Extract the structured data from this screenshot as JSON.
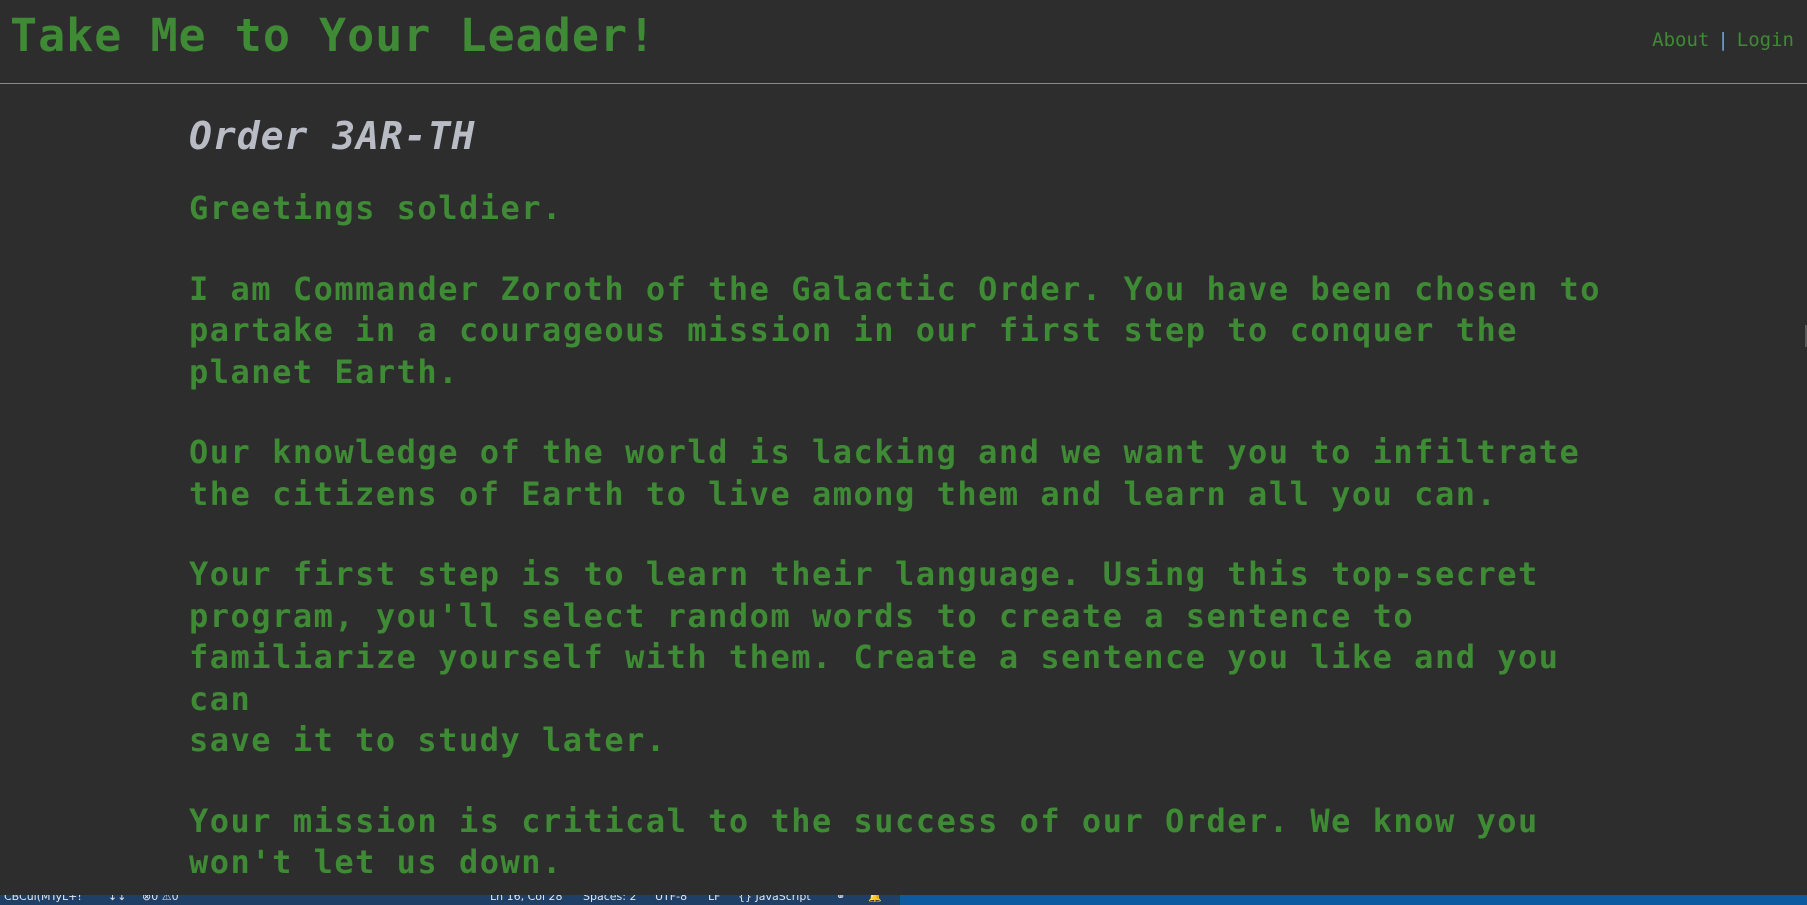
{
  "header": {
    "title": "Take Me to Your Leader!",
    "nav": {
      "about": "About",
      "separator": "|",
      "login": "Login"
    }
  },
  "main": {
    "order_title": "Order 3AR-TH",
    "paragraphs": [
      "Greetings soldier.",
      "I am Commander Zoroth of the Galactic Order. You have been chosen to\npartake in a courageous mission in our first step to conquer the\nplanet Earth.",
      "Our knowledge of the world is lacking and we want you to infiltrate\nthe citizens of Earth to live among them and learn all you can.",
      "Your first step is to learn their language. Using this top-secret\nprogram, you'll select random words to create a sentence to\nfamiliarize yourself with them. Create a sentence you like and you can\nsave it to study later.",
      "Your mission is critical to the success of our Order. We know you\nwon't let us down."
    ]
  },
  "statusbar": {
    "items": [
      "CBCul(MTyL+!",
      "↕↕",
      "⊗0 ⚠0",
      "Ln 16, Col 28",
      "Spaces: 2",
      "UTF-8",
      "LF",
      "{} JavaScript",
      "⚭",
      "🔔"
    ]
  },
  "colors": {
    "background": "#2d2d2d",
    "accent_green": "#3f8a35",
    "title_gray": "#b9bcc5",
    "nav_separator": "#6ca3d6",
    "statusbar": "#0e5aa0"
  }
}
